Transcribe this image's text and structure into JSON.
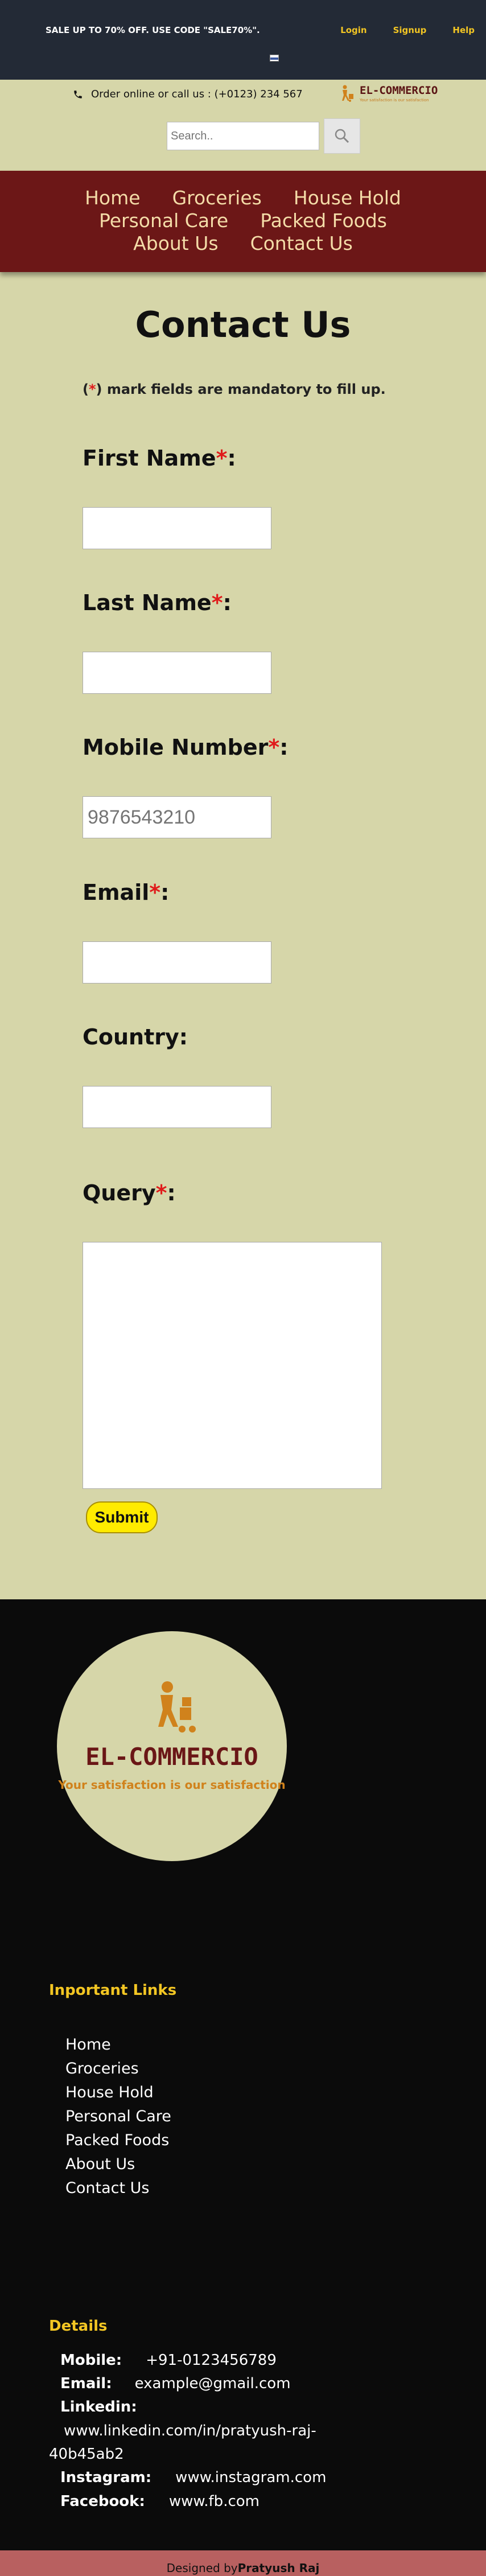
{
  "topbar": {
    "sale_text": "SALE UP TO 70% OFF. USE CODE \"SALE70%\".",
    "login": "Login",
    "signup": "Signup",
    "help": "Help"
  },
  "header": {
    "phone_text": "Order online or call us : (+0123) 234 567",
    "logo_title": "EL-COMMERCIO",
    "logo_tag": "Your satisfaction is our satisfaction",
    "search_placeholder": "Search.."
  },
  "nav": {
    "items": [
      "Home",
      "Groceries",
      "House Hold",
      "Personal Care",
      "Packed Foods",
      "About Us",
      "Contact Us"
    ]
  },
  "form": {
    "title": "Contact Us",
    "mandatory_star": "*",
    "mandatory_note": " mark fields are mandatory to fill up.",
    "first_name_label": "First Name",
    "last_name_label": "Last Name",
    "mobile_label": "Mobile Number",
    "mobile_placeholder": "9876543210",
    "email_label": "Email",
    "country_label": "Country:",
    "query_label": "Query",
    "star": "*",
    "colon": ":",
    "submit_label": "Submit"
  },
  "footer": {
    "logo_title": "EL-COMMERCIO",
    "logo_slogan": "Your satisfaction is our satisfaction",
    "links_title": "Inportant Links",
    "links": [
      "Home",
      "Groceries",
      "House Hold",
      "Personal Care",
      "Packed Foods",
      "About Us",
      "Contact Us"
    ],
    "details_title": "Details",
    "mobile_label": "Mobile:",
    "mobile_value": "+91-0123456789",
    "email_label": "Email:",
    "email_value": "example@gmail.com",
    "linkedin_label": "Linkedin:",
    "linkedin_value_1": "www.linkedin.com/in/pratyush-raj-",
    "linkedin_value_2": "40b45ab2",
    "instagram_label": "Instagram:",
    "instagram_value": "www.instagram.com",
    "facebook_label": "Facebook:",
    "facebook_value": "www.fb.com",
    "designed_by": "Designed by ",
    "designer": "Pratyush Raj"
  }
}
